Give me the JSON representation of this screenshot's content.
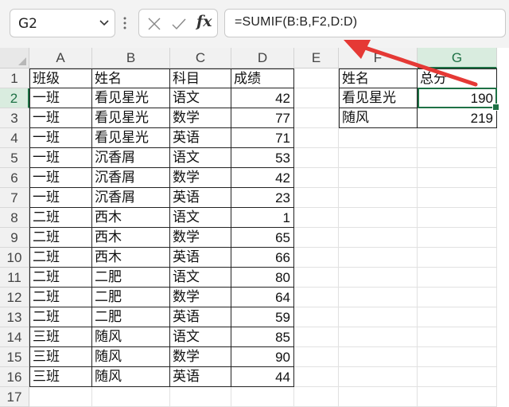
{
  "name_box": "G2",
  "fx_label": "fx",
  "formula": "=SUMIF(B:B,F2,D:D)",
  "columns": [
    "A",
    "B",
    "C",
    "D",
    "E",
    "F",
    "G"
  ],
  "selected_column": "G",
  "selected_row": 2,
  "rows": [
    {
      "n": "1",
      "a": "班级",
      "b": "姓名",
      "c": "科目",
      "d": "成绩",
      "f": "姓名",
      "g": "总分"
    },
    {
      "n": "2",
      "a": "一班",
      "b": "看见星光",
      "c": "语文",
      "d": "42",
      "f": "看见星光",
      "g": "190"
    },
    {
      "n": "3",
      "a": "一班",
      "b": "看见星光",
      "c": "数学",
      "d": "77",
      "f": "随风",
      "g": "219"
    },
    {
      "n": "4",
      "a": "一班",
      "b": "看见星光",
      "c": "英语",
      "d": "71"
    },
    {
      "n": "5",
      "a": "一班",
      "b": "沉香屑",
      "c": "语文",
      "d": "53"
    },
    {
      "n": "6",
      "a": "一班",
      "b": "沉香屑",
      "c": "数学",
      "d": "42"
    },
    {
      "n": "7",
      "a": "一班",
      "b": "沉香屑",
      "c": "英语",
      "d": "23"
    },
    {
      "n": "8",
      "a": "二班",
      "b": "西木",
      "c": "语文",
      "d": "1"
    },
    {
      "n": "9",
      "a": "二班",
      "b": "西木",
      "c": "数学",
      "d": "65"
    },
    {
      "n": "10",
      "a": "二班",
      "b": "西木",
      "c": "英语",
      "d": "66"
    },
    {
      "n": "11",
      "a": "二班",
      "b": "二肥",
      "c": "语文",
      "d": "80"
    },
    {
      "n": "12",
      "a": "二班",
      "b": "二肥",
      "c": "数学",
      "d": "64"
    },
    {
      "n": "13",
      "a": "二班",
      "b": "二肥",
      "c": "英语",
      "d": "59"
    },
    {
      "n": "14",
      "a": "三班",
      "b": "随风",
      "c": "语文",
      "d": "85"
    },
    {
      "n": "15",
      "a": "三班",
      "b": "随风",
      "c": "数学",
      "d": "90"
    },
    {
      "n": "16",
      "a": "三班",
      "b": "随风",
      "c": "英语",
      "d": "44"
    },
    {
      "n": "17"
    }
  ],
  "colors": {
    "accent": "#1e7145",
    "annotation_arrow": "#e53935"
  }
}
